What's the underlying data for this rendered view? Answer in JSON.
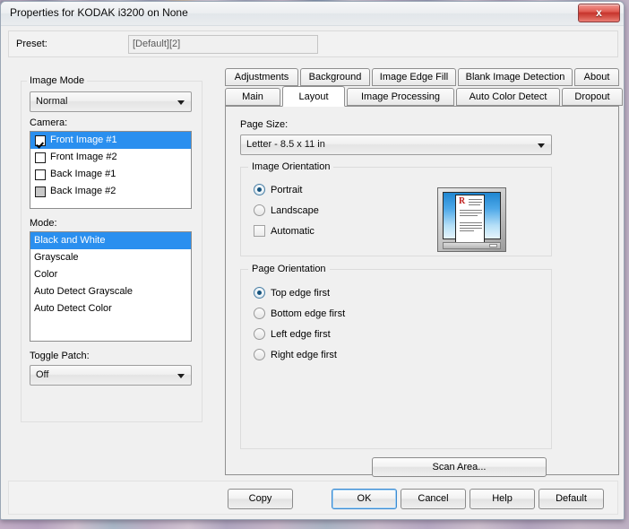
{
  "window": {
    "title": "Properties for KODAK i3200 on None",
    "close_label": "x"
  },
  "preset": {
    "label": "Preset:",
    "value": "[Default][2]"
  },
  "left_panel": {
    "image_mode": {
      "group_title": "Image Mode",
      "selected": "Normal"
    },
    "camera": {
      "label": "Camera:",
      "items": [
        {
          "label": "Front Image #1",
          "checked": true,
          "selected": true,
          "disabled": false
        },
        {
          "label": "Front Image #2",
          "checked": false,
          "selected": false,
          "disabled": false
        },
        {
          "label": "Back Image #1",
          "checked": false,
          "selected": false,
          "disabled": false
        },
        {
          "label": "Back Image #2",
          "checked": false,
          "selected": false,
          "disabled": true
        }
      ]
    },
    "mode": {
      "label": "Mode:",
      "items": [
        {
          "label": "Black and White",
          "selected": true
        },
        {
          "label": "Grayscale",
          "selected": false
        },
        {
          "label": "Color",
          "selected": false
        },
        {
          "label": "Auto Detect Grayscale",
          "selected": false
        },
        {
          "label": "Auto Detect Color",
          "selected": false
        }
      ]
    },
    "toggle_patch": {
      "label": "Toggle Patch:",
      "selected": "Off"
    }
  },
  "tabs": {
    "row1": [
      {
        "label": "Adjustments",
        "active": false
      },
      {
        "label": "Background",
        "active": false
      },
      {
        "label": "Image Edge Fill",
        "active": false
      },
      {
        "label": "Blank Image Detection",
        "active": false
      },
      {
        "label": "About",
        "active": false
      }
    ],
    "row2": [
      {
        "label": "Main",
        "active": false
      },
      {
        "label": "Layout",
        "active": true
      },
      {
        "label": "Image Processing",
        "active": false
      },
      {
        "label": "Auto Color Detect",
        "active": false
      },
      {
        "label": "Dropout",
        "active": false
      }
    ]
  },
  "layout_tab": {
    "page_size": {
      "label": "Page Size:",
      "selected": "Letter - 8.5 x 11 in"
    },
    "image_orientation": {
      "title": "Image Orientation",
      "options": [
        {
          "label": "Portrait",
          "selected": true
        },
        {
          "label": "Landscape",
          "selected": false
        }
      ],
      "automatic": {
        "label": "Automatic",
        "checked": false
      },
      "preview_initial": "R"
    },
    "page_orientation": {
      "title": "Page Orientation",
      "options": [
        {
          "label": "Top edge first",
          "selected": true
        },
        {
          "label": "Bottom edge first",
          "selected": false
        },
        {
          "label": "Left edge first",
          "selected": false
        },
        {
          "label": "Right edge first",
          "selected": false
        }
      ]
    },
    "scan_area_button": "Scan Area..."
  },
  "footer_buttons": [
    {
      "label": "Copy",
      "default": false
    },
    {
      "label": "OK",
      "default": true
    },
    {
      "label": "Cancel",
      "default": false
    },
    {
      "label": "Help",
      "default": false
    },
    {
      "label": "Default",
      "default": false
    }
  ],
  "colors": {
    "selection_blue": "#2a8fef",
    "close_red": "#c6342c",
    "preview_initial_red": "#c0201e",
    "dialog_face": "#f0f0f0"
  }
}
